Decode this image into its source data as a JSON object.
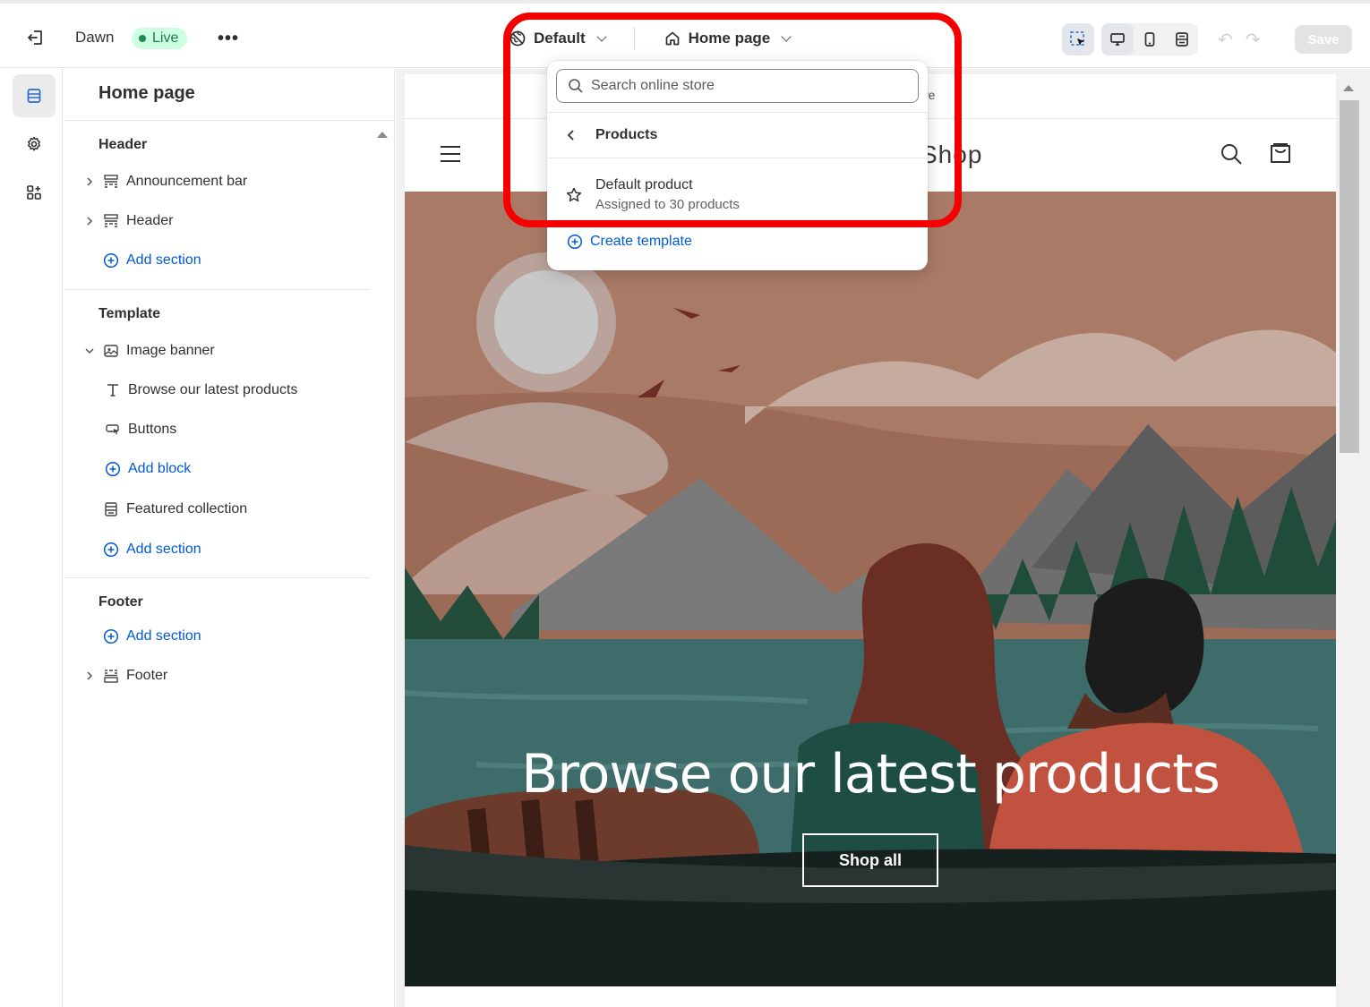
{
  "topbar": {
    "theme_name": "Dawn",
    "live_label": "Live",
    "more_label": "•••",
    "template_selector": "Default",
    "page_selector": "Home page",
    "save_label": "Save"
  },
  "sidebar": {
    "title": "Home page",
    "header_section": {
      "heading": "Header",
      "items": [
        {
          "label": "Announcement bar"
        },
        {
          "label": "Header"
        }
      ],
      "add_label": "Add section"
    },
    "template_section": {
      "heading": "Template",
      "image_banner": "Image banner",
      "blocks": [
        {
          "label": "Browse our latest products"
        },
        {
          "label": "Buttons"
        }
      ],
      "add_block_label": "Add block",
      "featured_collection": "Featured collection",
      "add_label": "Add section"
    },
    "footer_section": {
      "heading": "Footer",
      "add_label": "Add section",
      "footer_item": "Footer"
    }
  },
  "dropdown": {
    "search_placeholder": "Search online store",
    "back_label": "Products",
    "template_name": "Default product",
    "template_sub": "Assigned to 30 products",
    "create_label": "Create template"
  },
  "preview": {
    "announcement_text": "re",
    "store_name": "Shop",
    "banner_heading": "Browse our latest products",
    "banner_button": "Shop all"
  },
  "colors": {
    "accent_link": "#005bd3",
    "live_badge_bg": "#cdfee1",
    "highlight": "#f50000"
  }
}
